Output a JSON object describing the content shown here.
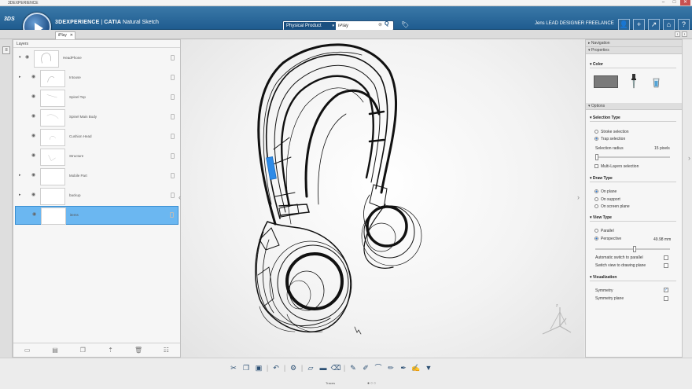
{
  "window": {
    "title": "3DEXPERIENCE",
    "controls": [
      "–",
      "□",
      "✕"
    ]
  },
  "header": {
    "brand": "3DEXPERIENCE",
    "separator": " | ",
    "app": "CATIA",
    "module": "Natural Sketch",
    "search_scope": "Physical Product",
    "search_value": "iPlay",
    "user": "Jens LEAD DESIGNER FREELANCE",
    "icons": [
      "user-icon",
      "add-icon",
      "share-icon",
      "home-icon",
      "help-icon"
    ]
  },
  "tabs": [
    {
      "label": "iPlay",
      "active": true
    }
  ],
  "layers": {
    "title": "Layers",
    "items": [
      {
        "name": "HeadPhone",
        "expand": "▾"
      },
      {
        "name": "Intouse",
        "expand": "▸"
      },
      {
        "name": "Spinel Top",
        "expand": ""
      },
      {
        "name": "Spinel Main Body",
        "expand": ""
      },
      {
        "name": "Cushion Head",
        "expand": ""
      },
      {
        "name": "Structure",
        "expand": ""
      },
      {
        "name": "Mobile Part",
        "expand": "▸"
      },
      {
        "name": "backup",
        "expand": "▸"
      },
      {
        "name": "items",
        "expand": ""
      }
    ],
    "selected_index": 8
  },
  "panel": {
    "navigation": "Navigation",
    "properties": "Properties",
    "color": "Color",
    "swatch_color": "#7a7a7a",
    "options": "Options",
    "selection_type": "Selection Type",
    "stroke_selection": "Stroke selection",
    "trap_selection": "Trap selection",
    "selection_radius_label": "Selection radius",
    "selection_radius_value": "15",
    "selection_radius_unit": "pixels",
    "multi_layers": "Multi-Layers selection",
    "draw_type": "Draw Type",
    "on_plane": "On plane",
    "on_support": "On support",
    "on_screen_plane": "On screen plane",
    "view_type": "View Type",
    "parallel": "Parallel",
    "perspective": "Perspective",
    "perspective_value": "49.98",
    "perspective_unit": "mm",
    "auto_switch": "Automatic switch to parallel",
    "switch_view": "Switch view to drawing plane",
    "visualization": "Visualization",
    "symmetry": "Symmetry",
    "symmetry_plane": "Symmetry plane"
  },
  "footer": {
    "traces": "Traces"
  }
}
